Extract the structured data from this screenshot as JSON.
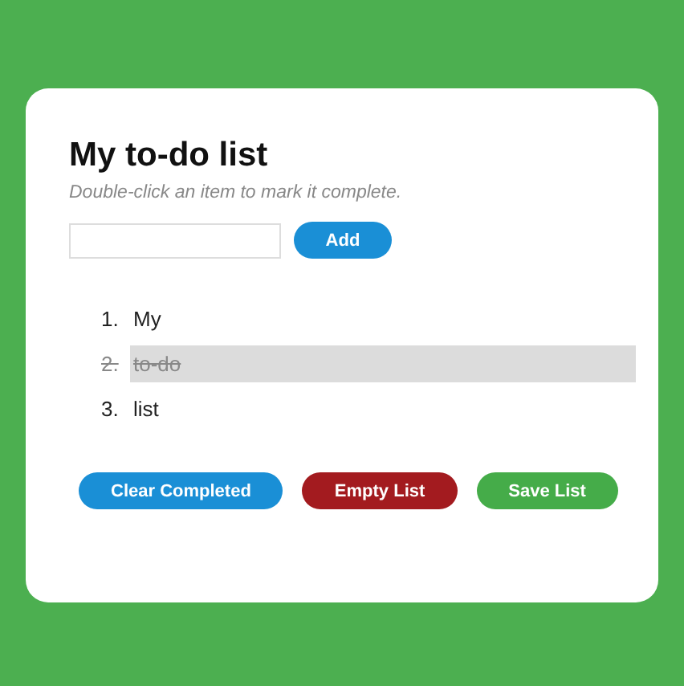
{
  "title": "My to-do list",
  "hint": "Double-click an item to mark it complete.",
  "add_button": "Add",
  "items": [
    {
      "number": "1.",
      "text": "My",
      "completed": false
    },
    {
      "number": "2.",
      "text": "to-do",
      "completed": true
    },
    {
      "number": "3.",
      "text": "list",
      "completed": false
    }
  ],
  "buttons": [
    {
      "label": "Clear Completed",
      "kind": "primary"
    },
    {
      "label": "Empty List",
      "kind": "danger"
    },
    {
      "label": "Save List",
      "kind": "success"
    }
  ]
}
